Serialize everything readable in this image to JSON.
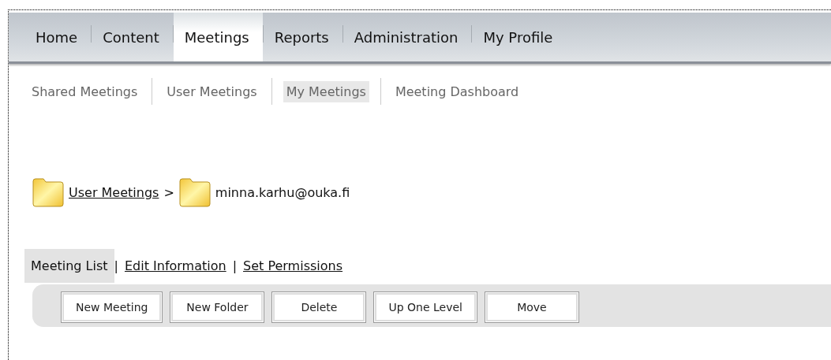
{
  "main_nav": [
    {
      "label": "Home",
      "selected": false
    },
    {
      "label": "Content",
      "selected": false
    },
    {
      "label": "Meetings",
      "selected": true
    },
    {
      "label": "Reports",
      "selected": false
    },
    {
      "label": "Administration",
      "selected": false
    },
    {
      "label": "My Profile",
      "selected": false
    }
  ],
  "sub_nav": [
    {
      "label": "Shared Meetings",
      "selected": false
    },
    {
      "label": "User Meetings",
      "selected": false
    },
    {
      "label": "My Meetings",
      "selected": true
    },
    {
      "label": "Meeting Dashboard",
      "selected": false
    }
  ],
  "breadcrumb": {
    "link": "User Meetings",
    "separator": ">",
    "current": "minna.karhu@ouka.fi"
  },
  "view_tabs": [
    {
      "label": "Meeting List",
      "selected": true
    },
    {
      "label": "Edit Information",
      "selected": false
    },
    {
      "label": "Set Permissions",
      "selected": false
    }
  ],
  "view_tab_separator": "|",
  "toolbar_buttons": [
    "New Meeting",
    "New Folder",
    "Delete",
    "Up One Level",
    "Move"
  ]
}
